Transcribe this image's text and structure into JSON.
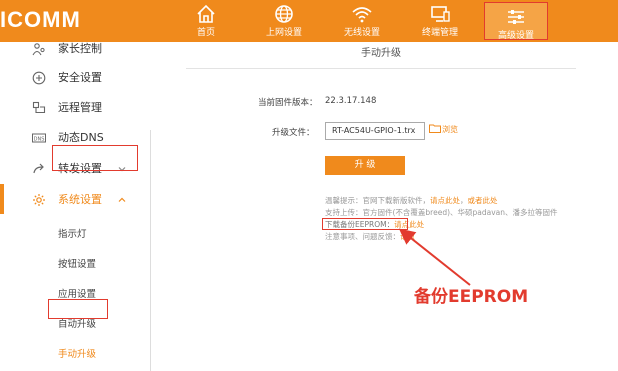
{
  "brand": {
    "logo_text": "ICOMM",
    "accent_color": "#f08a1c",
    "highlight_color": "#e23b2e"
  },
  "top_nav": {
    "items": [
      {
        "label": "首页",
        "icon": "home-icon"
      },
      {
        "label": "上网设置",
        "icon": "globe-icon"
      },
      {
        "label": "无线设置",
        "icon": "wifi-icon"
      },
      {
        "label": "终端管理",
        "icon": "device-icon"
      },
      {
        "label": "高级设置",
        "icon": "settings-sliders-icon",
        "active": true
      }
    ]
  },
  "sidebar": {
    "items": [
      {
        "label": "家长控制",
        "icon": "parental-icon"
      },
      {
        "label": "安全设置",
        "icon": "shield-icon"
      },
      {
        "label": "远程管理",
        "icon": "remote-icon"
      },
      {
        "label": "动态DNS",
        "icon": "dns-icon"
      },
      {
        "label": "转发设置",
        "icon": "forward-icon",
        "chevron": "down"
      },
      {
        "label": "系统设置",
        "icon": "gear-icon",
        "chevron": "up",
        "active": true
      }
    ],
    "sub_items": [
      {
        "label": "指示灯"
      },
      {
        "label": "按钮设置"
      },
      {
        "label": "应用设置"
      },
      {
        "label": "自动升级"
      },
      {
        "label": "手动升级",
        "active": true
      }
    ]
  },
  "main": {
    "title": "手动升级",
    "firmware_label": "当前固件版本：",
    "firmware_value": "22.3.17.148",
    "file_label": "升级文件：",
    "file_value": "RT-AC54U-GPIO-1.trx",
    "browse_label": "浏览",
    "upgrade_button": "升 级",
    "notes": {
      "line1_text": "温馨提示：官网下载新版软件，",
      "line1_link1": "请点此处",
      "line1_sep": "，",
      "line1_link2": "或者此处",
      "line2_text": "支持上传：官方固件(不含覆盖breed)、华硕padavan、潘多拉等固件",
      "line3_text": "下载备份EEPROM：",
      "line3_link": "请点此处",
      "line4_text": "注意事项、问题反馈：",
      "line4_link": "请点"
    }
  },
  "annotation": {
    "text": "备份EEPROM"
  }
}
